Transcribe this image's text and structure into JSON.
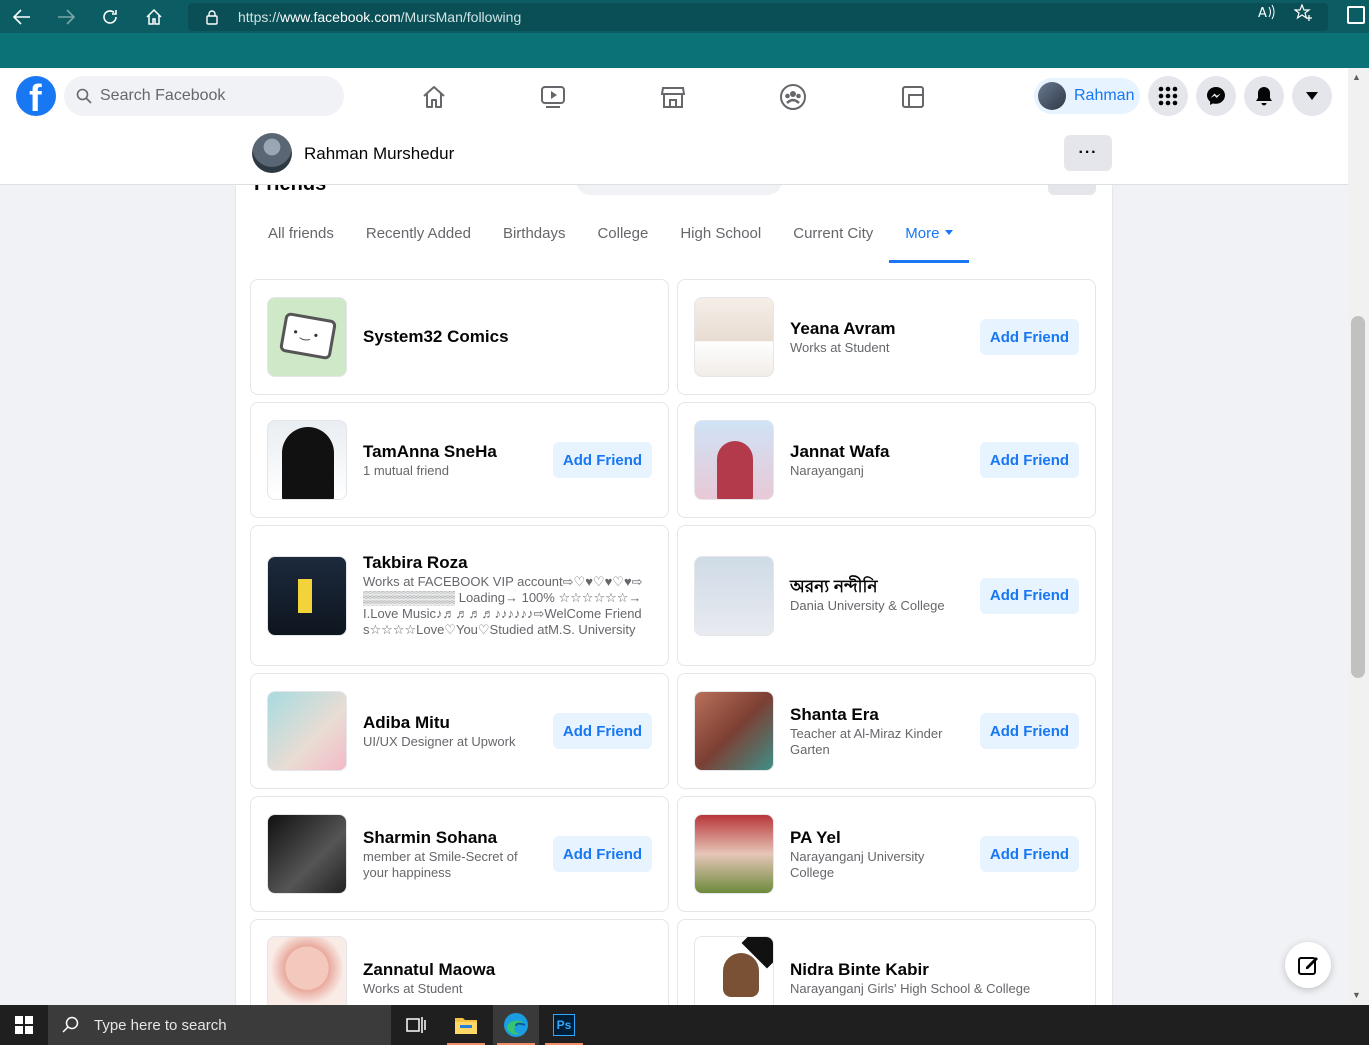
{
  "browser": {
    "url_prefix": "https://",
    "url_domain": "www.facebook.com",
    "url_path": "/MursMan/following"
  },
  "fb_nav": {
    "search_placeholder": "Search Facebook",
    "profile_chip_name": "Rahman",
    "brand_color": "#1877f2"
  },
  "profile_bar": {
    "name": "Rahman Murshedur",
    "more_label": "···"
  },
  "friends": {
    "heading": "Friends",
    "tabs": [
      "All friends",
      "Recently Added",
      "Birthdays",
      "College",
      "High School",
      "Current City",
      "More"
    ],
    "active_tab": "More",
    "add_friend_label": "Add Friend",
    "cards": [
      {
        "name": "System32 Comics",
        "sub": ""
      },
      {
        "name": "Yeana Avram",
        "sub": "Works at Student"
      },
      {
        "name": "TamAnna SneHa",
        "sub": "1 mutual friend"
      },
      {
        "name": "Jannat Wafa",
        "sub": "Narayanganj"
      },
      {
        "name": "Takbira Roza",
        "sub": "Works at FACEBOOK VIP account⇨♡♥♡♥♡♥⇨▒▒▒▒▒▒▒▒▒▒ Loading→ 100% ☆☆☆☆☆☆→I.Love Music♪♬♬♬♬♪♪♪♪♪♪⇨WelCome Friends☆☆☆☆Love♡You♡Studied atM.S. University"
      },
      {
        "name": "অরন্য নন্দীনি",
        "sub": "Dania University & College"
      },
      {
        "name": "Adiba Mitu",
        "sub": "UI/UX Designer at Upwork"
      },
      {
        "name": "Shanta Era",
        "sub": "Teacher at Al-Miraz Kinder Garten"
      },
      {
        "name": "Sharmin Sohana",
        "sub": "member at Smile-Secret of your happiness"
      },
      {
        "name": "PA Yel",
        "sub": "Narayanganj University College"
      },
      {
        "name": "Zannatul Maowa",
        "sub": "Works at Student"
      },
      {
        "name": "Nidra Binte Kabir",
        "sub": "Narayanganj Girls' High School & College"
      }
    ]
  },
  "taskbar": {
    "search_placeholder": "Type here to search",
    "ps_label": "Ps"
  }
}
